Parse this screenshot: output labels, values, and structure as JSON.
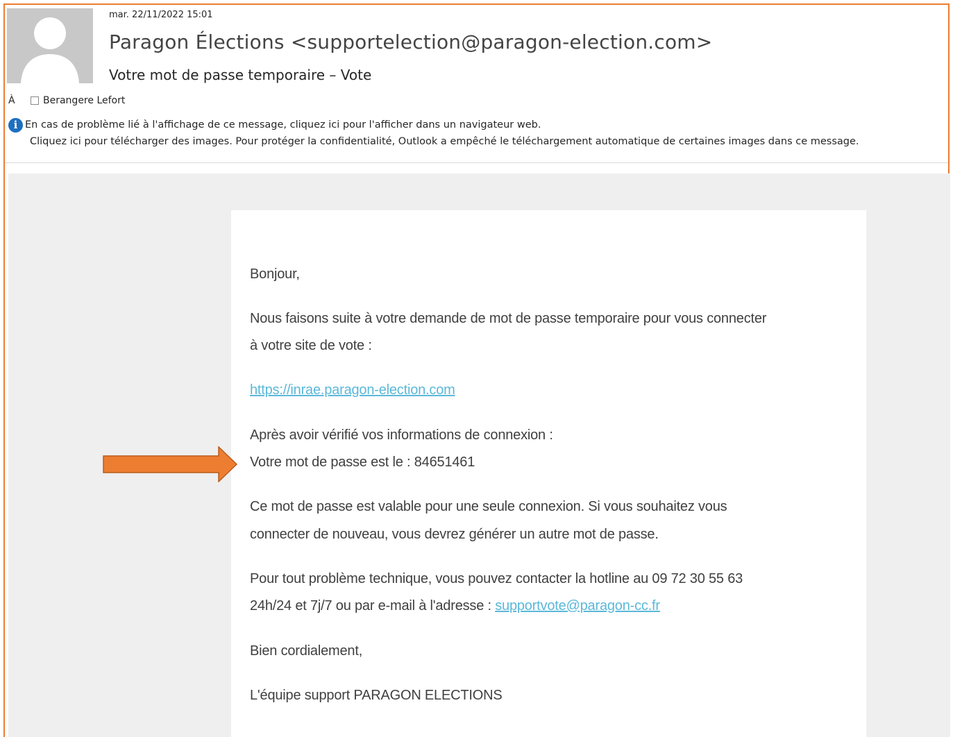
{
  "header": {
    "date": "mar. 22/11/2022 15:01",
    "from": "Paragon Élections <supportelection@paragon-election.com>",
    "subject": "Votre mot de passe temporaire – Vote",
    "to_label": "À",
    "to_recipient": "Berangere Lefort"
  },
  "info_bar": {
    "line1": "En cas de problème lié à l'affichage de ce message, cliquez ici pour l'afficher dans un navigateur web.",
    "line2": "Cliquez ici pour télécharger des images. Pour protéger la confidentialité, Outlook a empêché le téléchargement automatique de certaines images dans ce message."
  },
  "body": {
    "greeting": "Bonjour,",
    "para1_line1": "Nous faisons suite à votre demande de mot de passe temporaire pour vous connecter",
    "para1_line2": "à votre site de vote :",
    "site_link": "https://inrae.paragon-election.com",
    "para2_line1": "Après avoir vérifié vos informations de connexion :",
    "para2_line2": "Votre mot de passe est le : 84651461",
    "para3_line1": "Ce mot de passe est valable pour une seule connexion. Si vous souhaitez vous",
    "para3_line2": "connecter de nouveau, vous devrez générer un autre mot de passe.",
    "para4_line1": "Pour tout problème technique, vous pouvez contacter la hotline au 09 72 30 55 63",
    "para4_line2_prefix": "24h/24 et 7j/7 ou par e-mail à l'adresse : ",
    "support_email": "supportvote@paragon-cc.fr",
    "closing": "Bien cordialement,",
    "signature": "L'équipe support PARAGON ELECTIONS"
  },
  "colors": {
    "accent_orange": "#ED7D31",
    "link": "#5bb8d9",
    "info_icon": "#1e6fc0",
    "content_bg": "#efefef"
  }
}
